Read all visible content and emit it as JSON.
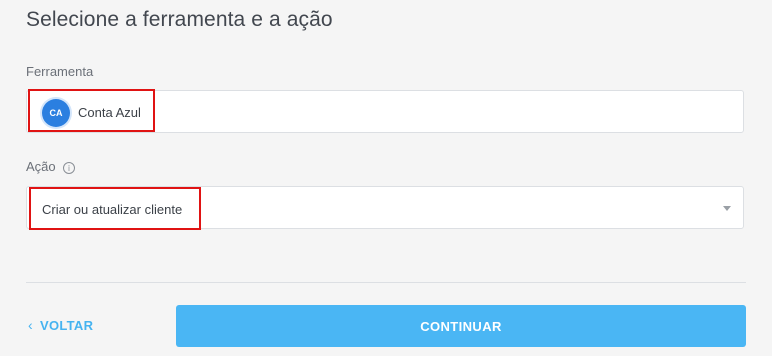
{
  "header": {
    "title": "Selecione a ferramenta e a ação"
  },
  "tool_field": {
    "label": "Ferramenta",
    "logo_text": "CA",
    "value": "Conta Azul"
  },
  "action_field": {
    "label": "Ação",
    "info_icon": "i",
    "value": "Criar ou atualizar cliente"
  },
  "footer": {
    "back_chevron": "‹",
    "back_label": "VOLTAR",
    "continue_label": "CONTINUAR"
  },
  "colors": {
    "accent": "#4ab6f4",
    "highlight": "#e01313",
    "logo": "#2b7fe0"
  }
}
